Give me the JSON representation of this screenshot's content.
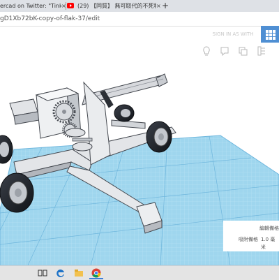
{
  "browser": {
    "tabs": [
      {
        "label": "ercad on Twitter: \"Tinkerca"
      },
      {
        "label": "(29) 【同質】 無可取代的不死稱"
      }
    ],
    "tab_close": "×",
    "new_tab": "+",
    "url": "gD1Xb72bK-copy-of-flak-37/edit"
  },
  "app": {
    "user_button_label": "SIGN IN AS WITH",
    "accent_color": "#4f8fd3",
    "tools": [
      "lightbulb-icon",
      "comment-icon",
      "copy-icon",
      "duplicate-icon",
      "ruler-icon"
    ]
  },
  "panel": {
    "edit_grid_label": "編輯備格",
    "snap_grid_label": "吸附備格",
    "snap_grid_value": "1.0 毫",
    "snap_grid_unit": "米"
  },
  "taskbar": {
    "icons": [
      "task-view-icon",
      "edge-icon",
      "file-explorer-icon",
      "chrome-icon"
    ]
  }
}
